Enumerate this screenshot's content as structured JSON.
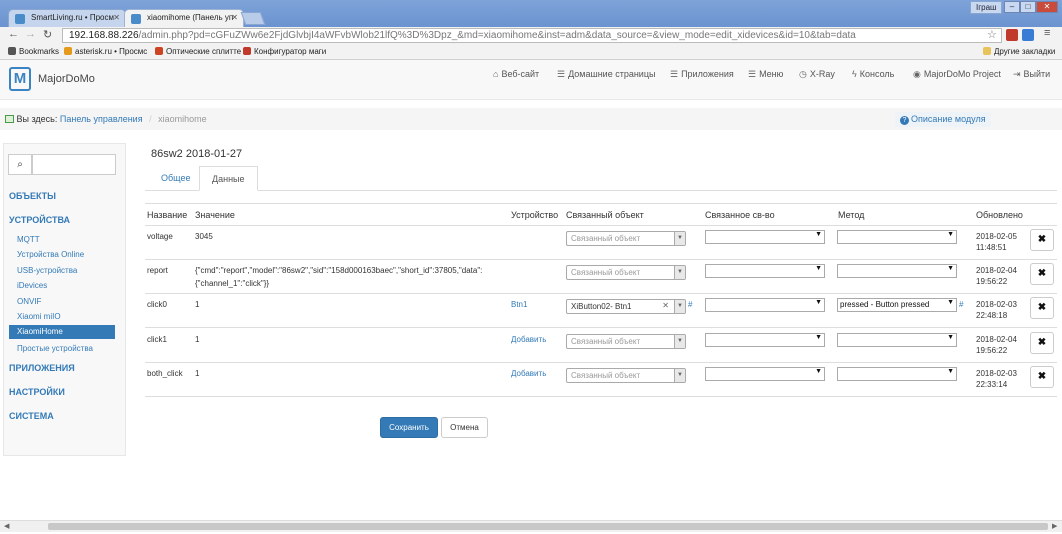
{
  "browser": {
    "tabs": [
      {
        "title": "SmartLiving.ru • Просм"
      },
      {
        "title": "xiaomihome (Панель уп"
      }
    ],
    "user": "Іграш",
    "url_host": "192.168.88.226",
    "url_path": "/admin.php?pd=cGFuZWw6e2FjdGlvbjI4aWFvbWlob21lfQ%3D%3Dpz_&md=xiaomihome&inst=adm&data_source=&view_mode=edit_xidevices&id=10&tab=data",
    "bookmarks": [
      {
        "label": "Bookmarks",
        "color": "#555555"
      },
      {
        "label": "asterisk.ru • Просмс",
        "color": "#e69a1a"
      },
      {
        "label": "Оптические сплитте",
        "color": "#cc4422"
      },
      {
        "label": "Конфигуратор маги",
        "color": "#c0392b"
      }
    ],
    "other_bookmarks": "Другие закладки"
  },
  "app": {
    "brand": "MajorDoMo",
    "nav": [
      {
        "icon": "home-icon",
        "glyph": "⌂",
        "label": "Веб-сайт"
      },
      {
        "icon": "list-icon",
        "glyph": "☰",
        "label": "Домашние страницы"
      },
      {
        "icon": "list-icon",
        "glyph": "☰",
        "label": "Приложения"
      },
      {
        "icon": "list-icon",
        "glyph": "☰",
        "label": "Меню"
      },
      {
        "icon": "clock-icon",
        "glyph": "◷",
        "label": "X-Ray"
      },
      {
        "icon": "bolt-icon",
        "glyph": "ϟ",
        "label": "Консоль"
      },
      {
        "icon": "globe-icon",
        "glyph": "◉",
        "label": "MajorDoMo Project"
      },
      {
        "icon": "logout-icon",
        "glyph": "⇥",
        "label": "Выйти"
      }
    ]
  },
  "breadcrumb": {
    "prefix": "Вы здесь:",
    "root": "Панель управления",
    "current": "xiaomihome"
  },
  "help_link": "Описание модуля",
  "sidebar": {
    "search_placeholder": "",
    "sections": {
      "objects": "ОБЪЕКТЫ",
      "devices": "УСТРОЙСТВА",
      "apps": "ПРИЛОЖЕНИЯ",
      "settings": "НАСТРОЙКИ",
      "system": "СИСТЕМА"
    },
    "device_items": [
      "MQTT",
      "Устройства Online",
      "USB-устройства",
      "iDevices",
      "ONVIF",
      "Xiaomi miIO",
      "XiaomiHome",
      "Простые устройства"
    ],
    "active_item": "XiaomiHome"
  },
  "page": {
    "title": "86sw2 2018-01-27",
    "tabs": [
      "Общее",
      "Данные"
    ],
    "active_tab": "Данные"
  },
  "table": {
    "headers": [
      "Название",
      "Значение",
      "Устройство",
      "Связанный объект",
      "Связанное св-во",
      "Метод",
      "Обновлено"
    ],
    "rows": [
      {
        "name": "voltage",
        "value": "3045",
        "device": "",
        "linked_object": "Связанный объект",
        "linked_object_set": false,
        "property": "",
        "method": "",
        "updated_date": "2018-02-05",
        "updated_time": "11:48:51"
      },
      {
        "name": "report",
        "value": "{\"cmd\":\"report\",\"model\":\"86sw2\",\"sid\":\"158d000163baec\",\"short_id\":37805,\"data\":{\"channel_1\":\"click\"}}",
        "device": "",
        "linked_object": "Связанный объект",
        "linked_object_set": false,
        "property": "",
        "method": "",
        "updated_date": "2018-02-04",
        "updated_time": "19:56:22"
      },
      {
        "name": "click0",
        "value": "1",
        "device": "Btn1",
        "linked_object": "XiButton02- Btn1",
        "linked_object_set": true,
        "property": "",
        "method": "pressed - Button pressed",
        "updated_date": "2018-02-03",
        "updated_time": "22:48:18"
      },
      {
        "name": "click1",
        "value": "1",
        "device": "Добавить",
        "linked_object": "Связанный объект",
        "linked_object_set": false,
        "property": "",
        "method": "",
        "updated_date": "2018-02-04",
        "updated_time": "19:56:22"
      },
      {
        "name": "both_click",
        "value": "1",
        "device": "Добавить",
        "linked_object": "Связанный объект",
        "linked_object_set": false,
        "property": "",
        "method": "",
        "updated_date": "2018-02-03",
        "updated_time": "22:33:14"
      }
    ]
  },
  "buttons": {
    "save": "Сохранить",
    "cancel": "Отмена",
    "delete_glyph": "✖",
    "hash": "#"
  }
}
